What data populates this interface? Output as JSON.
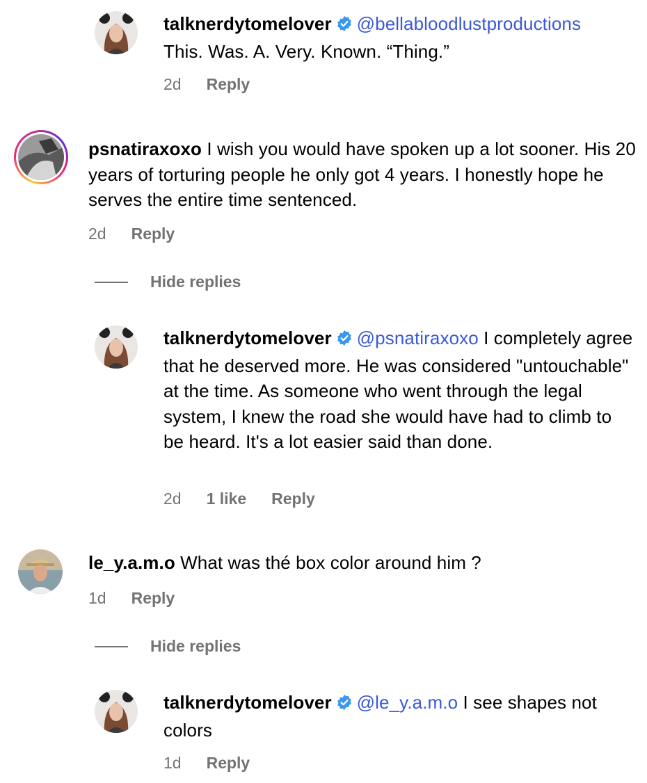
{
  "comments": [
    {
      "username": "talknerdytomelover",
      "verified": true,
      "mention": "@bellabloodlustproductions",
      "text": "This. Was. A. Very. Known. “Thing.”",
      "time": "2d",
      "reply": "Reply"
    },
    {
      "username": "psnatiraxoxo",
      "verified": false,
      "text": "I wish you would have spoken up a lot sooner. His 20 years of torturing people he only got 4 years. I honestly hope he serves the entire time sentenced.",
      "time": "2d",
      "reply": "Reply",
      "hide_replies": "Hide replies"
    },
    {
      "username": "talknerdytomelover",
      "verified": true,
      "mention": "@psnatiraxoxo",
      "text": "I completely agree that he deserved more. He was considered \"untouchable\" at the time. As someone who went through the legal system, I knew the road she would have had to climb to be heard. It's a lot easier said than done.",
      "time": "2d",
      "likes": "1 like",
      "reply": "Reply"
    },
    {
      "username": "le_y.a.m.o",
      "verified": false,
      "text": "What was thé box color around him ?",
      "time": "1d",
      "reply": "Reply",
      "hide_replies": "Hide replies"
    },
    {
      "username": "talknerdytomelover",
      "verified": true,
      "mention": "@le_y.a.m.o",
      "text": "I see shapes not colors",
      "time": "1d",
      "reply": "Reply"
    }
  ],
  "colors": {
    "mention": "#3a59d8",
    "meta": "#737373",
    "verified": "#3897f0"
  }
}
